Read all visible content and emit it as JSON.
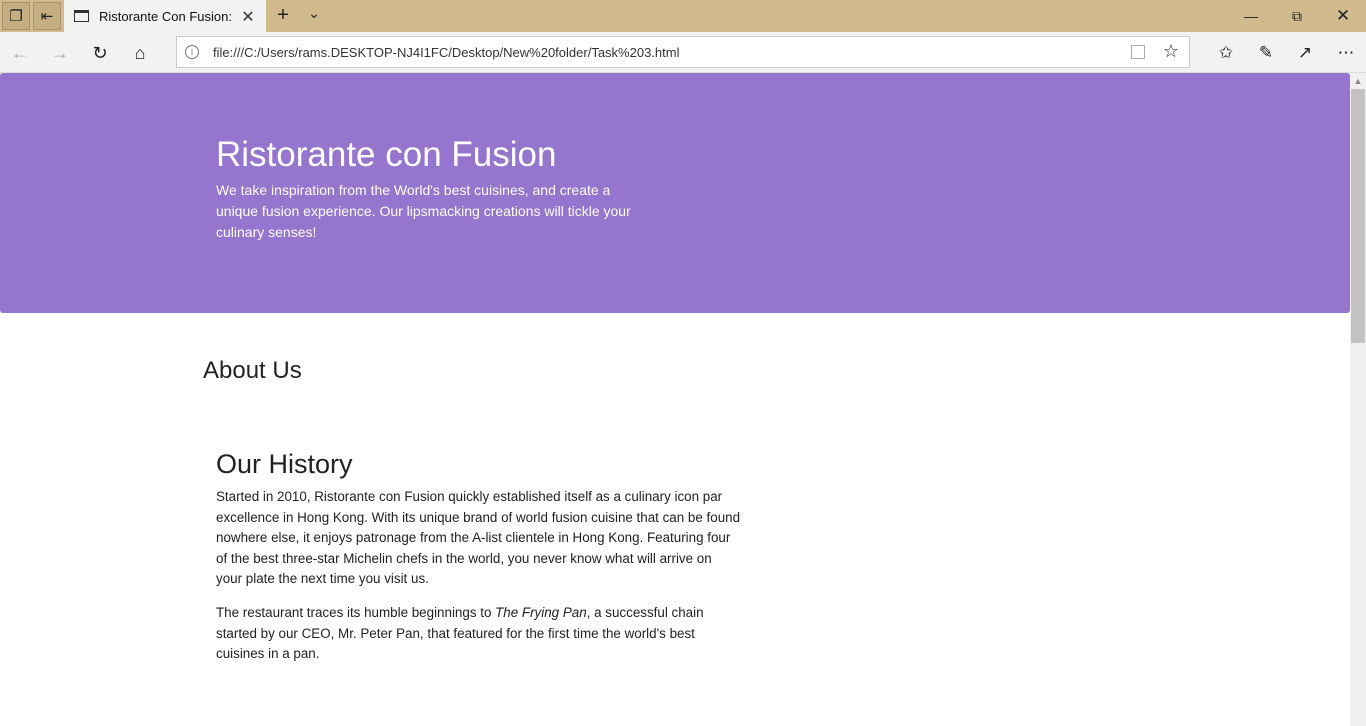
{
  "browser": {
    "tab_title": "Ristorante Con Fusion: A",
    "address": "file:///C:/Users/rams.DESKTOP-NJ4I1FC/Desktop/New%20folder/Task%203.html",
    "icons": {
      "tab_manager": "tabs-aside-icon",
      "set_aside": "set-tabs-aside-icon",
      "new_tab": "plus-icon",
      "tab_list": "chevron-down-icon",
      "minimize": "minimize-icon",
      "restore": "restore-icon",
      "close": "close-icon",
      "back": "back-arrow-icon",
      "forward": "forward-arrow-icon",
      "refresh": "refresh-icon",
      "home": "home-icon",
      "favorites_bar": "favorites-icon",
      "notes": "pen-icon",
      "share": "share-icon",
      "more": "more-icon"
    }
  },
  "page": {
    "jumbotron": {
      "title": "Ristorante con Fusion",
      "text": "We take inspiration from the World's best cuisines, and create a unique fusion experience. Our lipsmacking creations will tickle your culinary senses!"
    },
    "about_heading": "About Us",
    "history": {
      "heading": "Our History",
      "paragraph1": "Started in 2010, Ristorante con Fusion quickly established itself as a culinary icon par excellence in Hong Kong. With its unique brand of world fusion cuisine that can be found nowhere else, it enjoys patronage from the A-list clientele in Hong Kong. Featuring four of the best three-star Michelin chefs in the world, you never know what will arrive on your plate the next time you visit us.",
      "paragraph2_before": "The restaurant traces its humble beginnings to ",
      "paragraph2_em": "The Frying Pan",
      "paragraph2_after": ", a successful chain started by our CEO, Mr. Peter Pan, that featured for the first time the world's best cuisines in a pan."
    }
  },
  "colors": {
    "jumbotron_bg": "#9575cd",
    "titlebar_bg": "#d1bb8e"
  }
}
